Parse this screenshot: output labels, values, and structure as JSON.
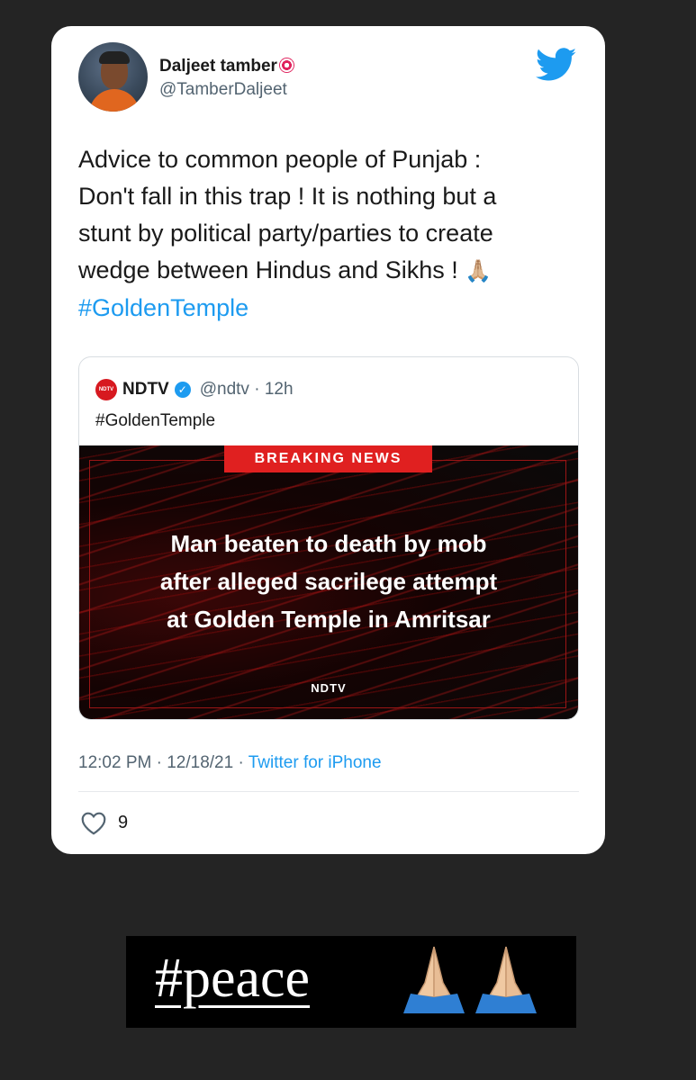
{
  "tweet": {
    "user_name": "Daljeet tamber",
    "user_handle": "@TamberDaljeet",
    "text_lines": [
      "Advice to common people of Punjab :",
      "Don't fall in this trap ! It is nothing but a",
      "stunt by political party/parties to create",
      "wedge between Hindus and Sikhs ! "
    ],
    "text_emoji": "🙏🏼",
    "hashtag": "#GoldenTemple",
    "timestamp": "12:02 PM · 12/18/21 · ",
    "source": "Twitter for iPhone",
    "likes": "9"
  },
  "quote": {
    "logo_text": "NDTV",
    "name": "NDTV",
    "handle_time": "@ndtv · 12h",
    "text": "#GoldenTemple",
    "media": {
      "tag": "BREAKING NEWS",
      "headline_lines": [
        "Man beaten to death by mob",
        "after alleged sacrilege attempt",
        "at Golden Temple in Amritsar"
      ],
      "brand": "NDTV"
    }
  },
  "banner": {
    "text": "#peace"
  },
  "icons": [
    "twitter-bird-icon",
    "verified-icon",
    "heart-icon",
    "target-icon",
    "folded-hands-icon"
  ],
  "colors": {
    "accent": "#1d9bf0",
    "breaking": "#e02020",
    "background": "#242424"
  }
}
